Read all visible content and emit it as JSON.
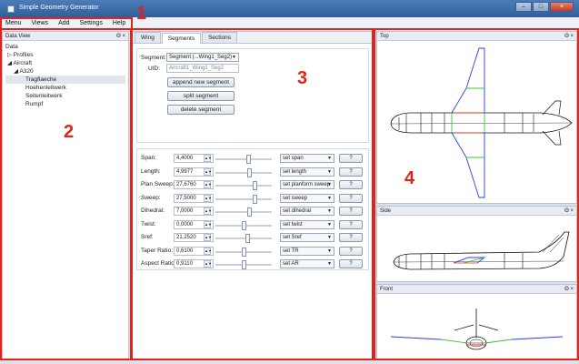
{
  "window": {
    "title": "Simple Geometry Generator",
    "minimize_icon": "minimize-icon",
    "maximize_icon": "maximize-icon",
    "close_icon": "close-icon"
  },
  "menu": [
    "Menu",
    "Views",
    "Add",
    "Settings",
    "Help"
  ],
  "data_view": {
    "title": "Data View",
    "controls": "Θ ×",
    "root": "Data",
    "tree": [
      {
        "label": "▷ Profiles",
        "indent": 0
      },
      {
        "label": "◢ Aircraft",
        "indent": 0
      },
      {
        "label": "◢ A320",
        "indent": 1
      },
      {
        "label": "Tragflaeche",
        "indent": 2,
        "selected": true
      },
      {
        "label": "Hoehenleitwerk",
        "indent": 2
      },
      {
        "label": "Seitenleitwerk",
        "indent": 2
      },
      {
        "label": "Rumpf",
        "indent": 2
      }
    ]
  },
  "tabs": [
    "Wing",
    "Segments",
    "Sections"
  ],
  "active_tab": "Segments",
  "segment_panel": {
    "segment_label": "Segment:",
    "segment_value": "Segment (...Wing1_Seg2)",
    "uid_label": "UID:",
    "uid_value": "Aircraft1_Wing1_Seg2",
    "buttons": [
      "append new segment",
      "split segment",
      "delete segment"
    ]
  },
  "parameters": [
    {
      "label": "Span:",
      "value": "4,4000",
      "slider": 0.6,
      "set": "set span"
    },
    {
      "label": "Length:",
      "value": "4,9977",
      "slider": 0.62,
      "set": "set length"
    },
    {
      "label": "Plan Sweep:",
      "value": "27,6760",
      "slider": 0.72,
      "set": "set planform sweep"
    },
    {
      "label": "Sweep:",
      "value": "27,5000",
      "slider": 0.72,
      "set": "set sweep"
    },
    {
      "label": "Dihedral:",
      "value": "7,0000",
      "slider": 0.62,
      "set": "set dihedral"
    },
    {
      "label": "Twist:",
      "value": "0,0000",
      "slider": 0.5,
      "set": "set twist"
    },
    {
      "label": "Sref:",
      "value": "21,2520",
      "slider": 0.58,
      "set": "set Sref"
    },
    {
      "label": "Taper Ratio:",
      "value": "0,6100",
      "slider": 0.5,
      "set": "set TR"
    },
    {
      "label": "Aspect Ratio:",
      "value": "0,9110",
      "slider": 0.5,
      "set": "set AR"
    }
  ],
  "help_label": "?",
  "views": [
    {
      "title": "Top",
      "controls": "Θ ×"
    },
    {
      "title": "Side",
      "controls": "Θ ×"
    },
    {
      "title": "Front",
      "controls": "Θ ×"
    }
  ],
  "annotations": [
    "1",
    "2",
    "3",
    "4"
  ],
  "colors": {
    "annotation_red": "#e2231a",
    "wing_blue": "#2a3fd8",
    "section_green": "#3fbf3a",
    "section_red": "#d8302a"
  }
}
